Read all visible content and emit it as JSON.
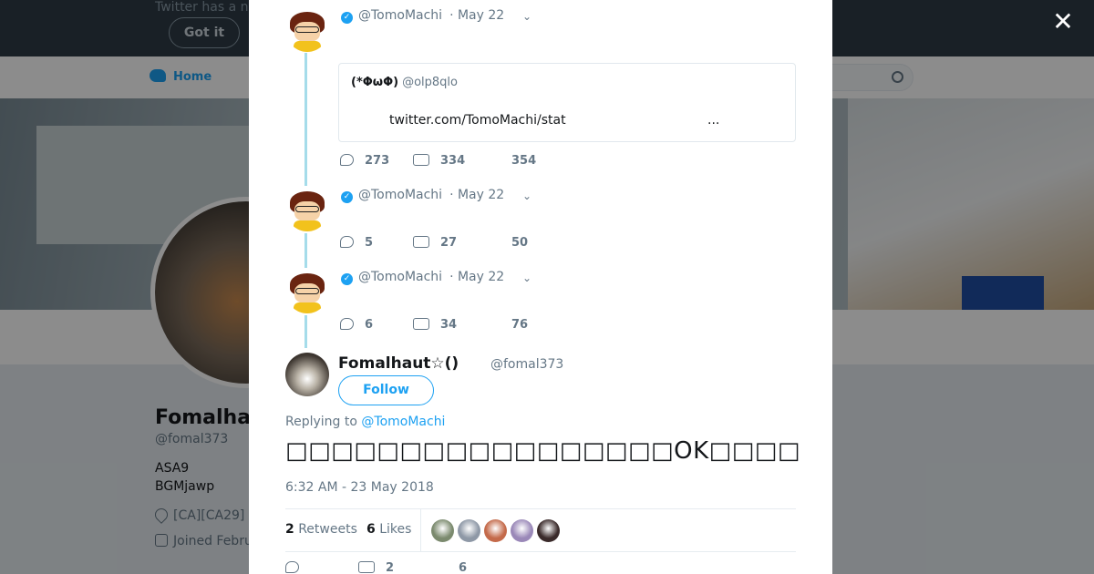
{
  "background": {
    "notice_text": "Twitter has a n",
    "got_it_label": "Got it",
    "nav_home_label": "Home",
    "profile_name": "Fomalhau",
    "profile_handle": "@fomal373",
    "bio_line1": "ASA9",
    "bio_line2": "BGMjawp",
    "location": "[CA][CA29]",
    "joined": "Joined Febru"
  },
  "modal": {
    "close_glyph": "✕",
    "thread": [
      {
        "handle": "@TomoMachi",
        "date": "· May 22",
        "quote": {
          "name": "(*ΦωΦ)",
          "handle": "@olp8qlo",
          "text": "twitter.com/TomoMachi/stat",
          "ellipsis": "..."
        },
        "replies": "273",
        "retweets": "334",
        "likes": "354"
      },
      {
        "handle": "@TomoMachi",
        "date": "· May 22",
        "replies": "5",
        "retweets": "27",
        "likes": "50"
      },
      {
        "handle": "@TomoMachi",
        "date": "· May 22",
        "replies": "6",
        "retweets": "34",
        "likes": "76"
      }
    ],
    "main_tweet": {
      "name": "Fomalhaut☆()",
      "handle": "@fomal373",
      "follow_label": "Follow",
      "replying_prefix": "Replying to",
      "replying_to": "@TomoMachi",
      "text": "□□□□□□□□□□□□□□□□□OK□□□□",
      "timestamp": "6:32 AM - 23 May 2018",
      "retweet_count": "2",
      "retweets_label": "Retweets",
      "like_count": "6",
      "likes_label": "Likes",
      "bottom_retweets": "2",
      "bottom_likes": "6"
    },
    "likers": [
      "#7b8a6e",
      "#8e98a6",
      "#c46a4a",
      "#9a88b8",
      "#3a2a2a"
    ]
  },
  "colors": {
    "accent": "#1da1f2",
    "thread_line": "#a5dcea"
  }
}
